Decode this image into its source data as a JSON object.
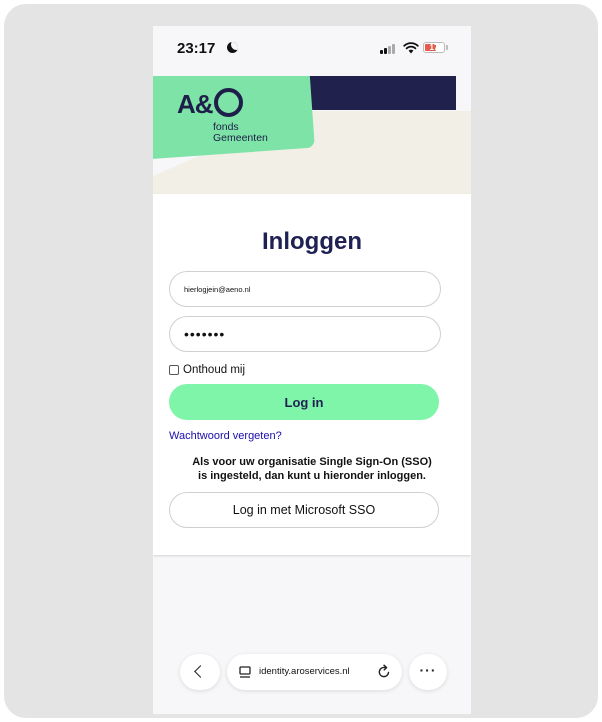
{
  "status_bar": {
    "time": "23:17",
    "battery": "17"
  },
  "logo": {
    "mark": "A&",
    "line1": "fonds",
    "line2": "Gemeenten"
  },
  "login": {
    "title": "Inloggen",
    "email_value": "hierlogjein@aeno.nl",
    "password_value": "•••••••",
    "remember_label": "Onthoud mij",
    "login_button": "Log in",
    "forgot_link": "Wachtwoord vergeten?",
    "sso_line1": "Als voor uw organisatie Single Sign-On (SSO)",
    "sso_line2": "is ingesteld, dan kunt u hieronder inloggen.",
    "sso_button": "Log in met Microsoft SSO"
  },
  "browser": {
    "url": "identity.aroservices.nl",
    "more": "···"
  },
  "colors": {
    "brand_green": "#7ee3a6",
    "button_green": "#7ef5a8",
    "navy": "#21214e",
    "link": "#1a0dab",
    "battery_low": "#e35d4c"
  }
}
